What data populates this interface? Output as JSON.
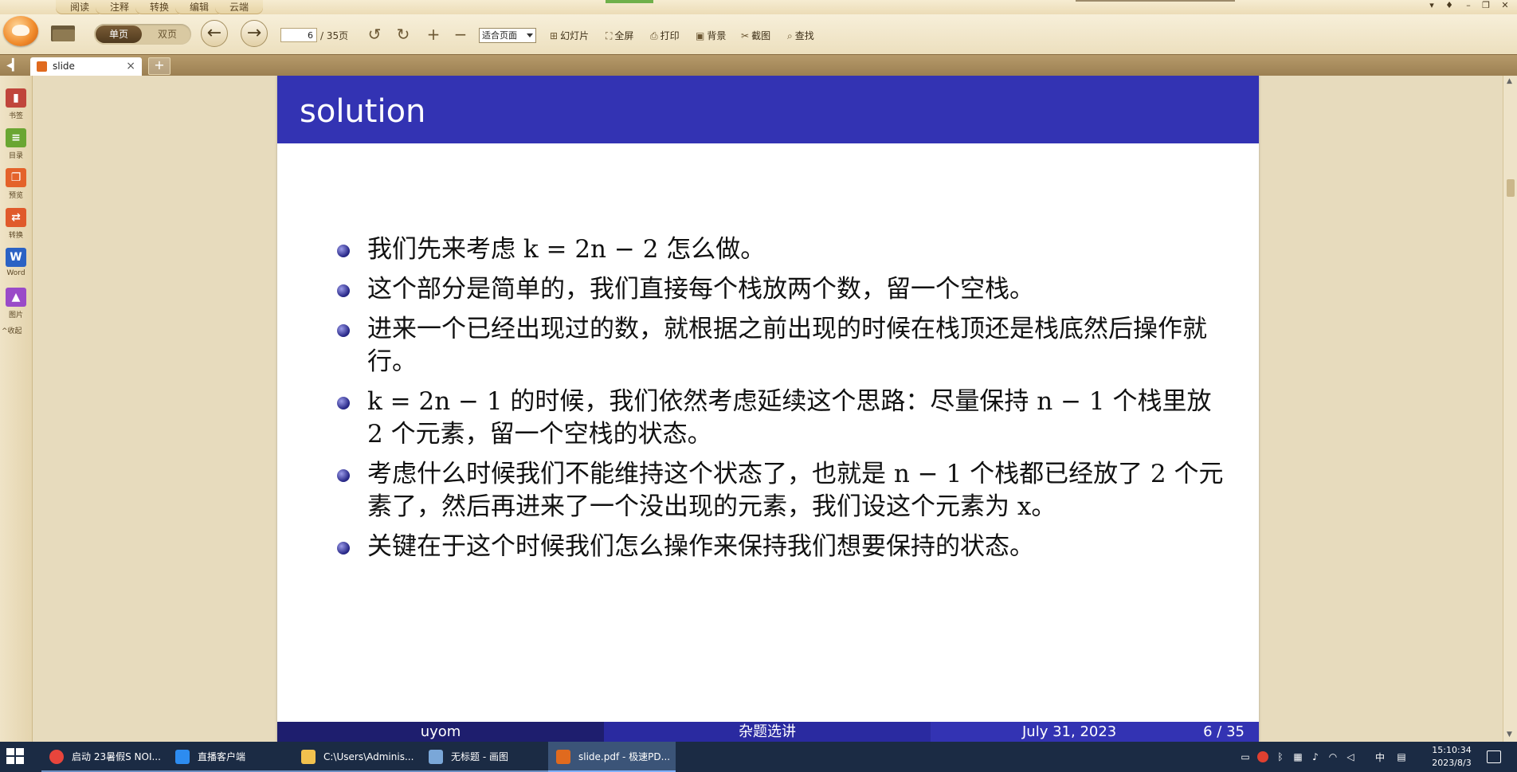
{
  "menu": {
    "tabs": [
      "阅读",
      "注释",
      "转换",
      "编辑",
      "云端"
    ]
  },
  "toolbar": {
    "single_page": "单页",
    "double_page": "双页",
    "current_page": "6",
    "total_pages": "/ 35页",
    "zoom": "适合页面",
    "slideshow": "幻灯片",
    "fullscreen": "全屏",
    "print": "打印",
    "background": "背景",
    "screenshot": "截图",
    "find": "查找"
  },
  "tabs": {
    "document": "slide",
    "close": "×",
    "new": "+"
  },
  "sidebar": {
    "items": [
      {
        "label": "书签",
        "icon": "bookmark-icon",
        "color": "#c0453b"
      },
      {
        "label": "目录",
        "icon": "toc-icon",
        "color": "#6aa632"
      },
      {
        "label": "预览",
        "icon": "preview-icon",
        "color": "#e4622a"
      },
      {
        "label": "转换",
        "icon": "convert-icon",
        "color": "#e05a2b"
      },
      {
        "label": "Word",
        "icon": "word-icon",
        "color": "#2b62c4"
      },
      {
        "label": "图片",
        "icon": "image-icon",
        "color": "#9a4ac8"
      }
    ],
    "collapse": "^收起"
  },
  "slide": {
    "title": "solution",
    "title_bar_color": "#3333b3",
    "bullets": [
      "我们先来考虑 k = 2n − 2 怎么做。",
      "这个部分是简单的，我们直接每个栈放两个数，留一个空栈。",
      "进来一个已经出现过的数，就根据之前出现的时候在栈顶还是栈底然后操作就行。",
      "k = 2n − 1 的时候，我们依然考虑延续这个思路：尽量保持 n − 1 个栈里放 2 个元素，留一个空栈的状态。",
      "考虑什么时候我们不能维持这个状态了，也就是 n − 1 个栈都已经放了 2 个元素了，然后再进来了一个没出现的元素，我们设这个元素为 x。",
      "关键在于这个时候我们怎么操作来保持我们想要保持的状态。"
    ],
    "footer": {
      "author": "uyom",
      "title": "杂题选讲",
      "date": "July 31, 2023",
      "page": "6 / 35"
    }
  },
  "taskbar": {
    "tasks": [
      {
        "label": "启动 23暑假S NOI...",
        "icon": "chrome-icon",
        "color": "#e8453c"
      },
      {
        "label": "直播客户端",
        "icon": "cloud-icon",
        "color": "#2d8cf0"
      },
      {
        "label": "C:\\Users\\Adminis...",
        "icon": "folder-icon",
        "color": "#f2c14e"
      },
      {
        "label": "无标题 - 画图",
        "icon": "paint-icon",
        "color": "#7aa7d8"
      },
      {
        "label": "slide.pdf - 极速PD...",
        "icon": "pdf-icon",
        "color": "#e06a1e"
      }
    ],
    "ime": "中",
    "time": "15:10:34",
    "date": "2023/8/3"
  }
}
